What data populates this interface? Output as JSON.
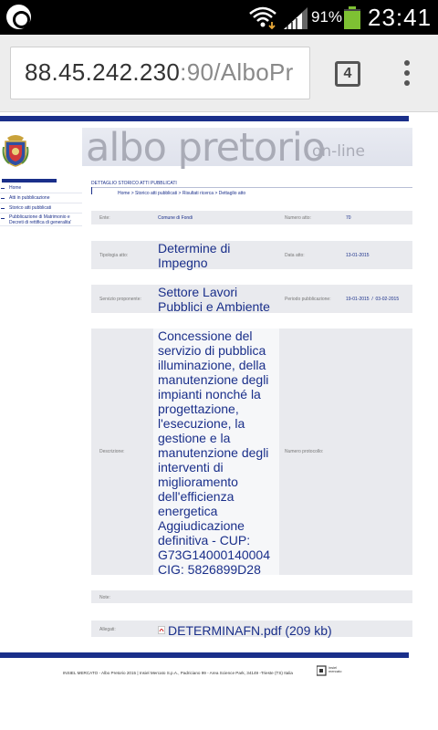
{
  "status_bar": {
    "battery_percent": "91%",
    "time": "23:41",
    "icons": [
      "app-icon",
      "wifi-icon",
      "signal-icon",
      "battery-icon"
    ]
  },
  "browser": {
    "url_host": "88.45.242.230",
    "url_rest": ":90/AlboPr",
    "tab_count": "4"
  },
  "site": {
    "title": "albo pretorio",
    "subtitle": "on-line"
  },
  "nav": {
    "items": [
      {
        "label": "Home"
      },
      {
        "label": "Atti in pubblicazione"
      },
      {
        "label": "Storico atti pubblicati"
      },
      {
        "label": "Pubblicazione di Matrimonio e Decreti di rettifica di generalita'"
      }
    ]
  },
  "detail": {
    "section_title": "DETTAGLIO STORICO ATTI PUBBLICATI",
    "breadcrumb": "Home > Storico atti pubblicati > Risultati ricerca > Dettaglio atto",
    "ente_label": "Ente:",
    "ente_value": "Comune di Fondi",
    "numero_atto_label": "Numero atto:",
    "numero_atto_value": "70",
    "tipologia_label": "Tipologia atto:",
    "tipologia_value": "Determine di Impegno",
    "data_atto_label": "Data atto:",
    "data_atto_value": "13-01-2015",
    "servizio_label": "Servizio proponente:",
    "servizio_value": "Settore Lavori Pubblici e Ambiente",
    "periodo_label": "Periodo pubblicazione:",
    "periodo_value": "19-01-2015  /  03-02-2015",
    "descrizione_label": "Descrizione:",
    "descrizione_value": "Concessione del servizio di pubblica illuminazione, della manutenzione degli impianti nonché la progettazione, l'esecuzione, la gestione e la manutenzione degli interventi di miglioramento dell'efficienza energetica Aggiudicazione definitiva - CUP: G73G14000140004 CIG: 5826899D28",
    "protocollo_label": "Numero protocollo:",
    "note_label": "Note:",
    "allegati_label": "Allegati:",
    "allegato_link": "DETERMINAFN.pdf (209 kb)"
  },
  "footer": {
    "text": "INSIEL MERCATO - Albo Pretorio 2015 | Insiel Mercato S.p.A., Padriciano 99 - Area Science Park, 34149 -Trieste (TS) Italia",
    "logo_text": "insiel mercato"
  },
  "colors": {
    "primary": "#1a2f8a",
    "row_bg": "#e9eaee",
    "banner_text": "#a9abb6"
  }
}
